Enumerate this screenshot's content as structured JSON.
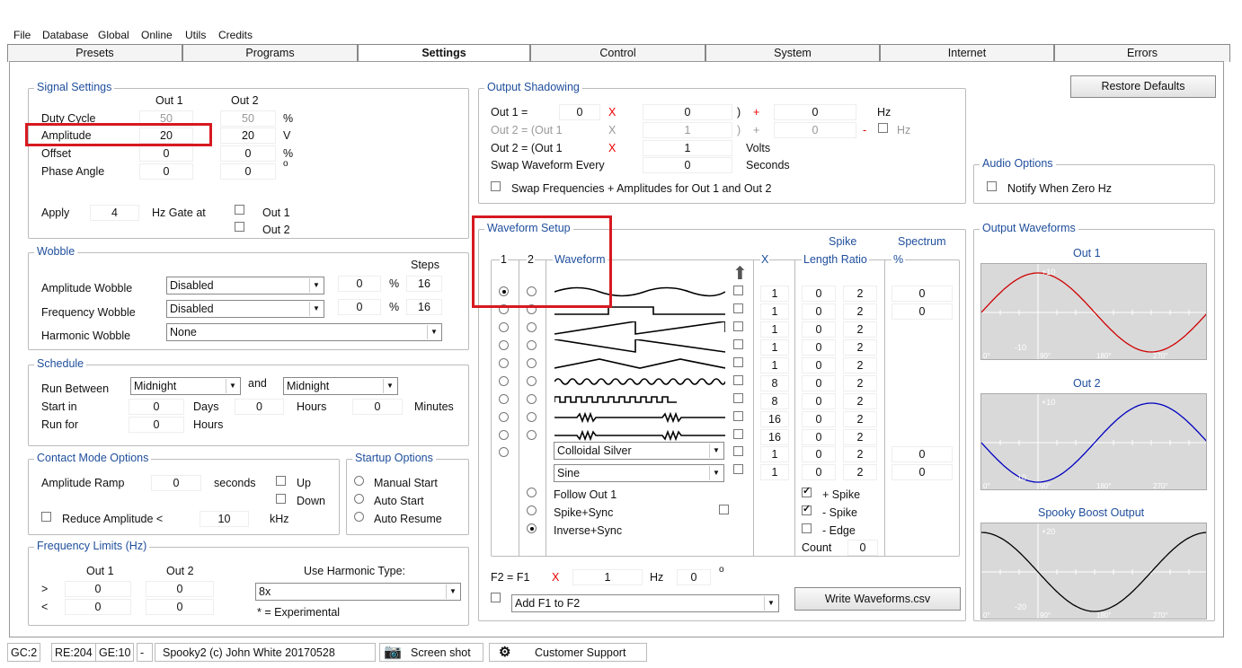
{
  "menu": [
    "File",
    "Database",
    "Global",
    "Online",
    "Utils",
    "Credits"
  ],
  "tabs": [
    "Presets",
    "Programs",
    "Settings",
    "Control",
    "System",
    "Internet",
    "Errors"
  ],
  "signal": {
    "title": "Signal Settings",
    "out1": "Out 1",
    "out2": "Out 2",
    "rows": [
      {
        "label": "Duty Cycle",
        "v1": "50",
        "v2": "50",
        "unit": "%"
      },
      {
        "label": "Amplitude",
        "v1": "20",
        "v2": "20",
        "unit": "V"
      },
      {
        "label": "Offset",
        "v1": "0",
        "v2": "0",
        "unit": "%"
      },
      {
        "label": "Phase Angle",
        "v1": "0",
        "v2": "0",
        "unit": "o"
      }
    ],
    "apply": "Apply",
    "apply_val": "4",
    "hz_gate": "Hz Gate at",
    "gate_out1": "Out 1",
    "gate_out2": "Out 2"
  },
  "wobble": {
    "title": "Wobble",
    "steps": "Steps",
    "amp_label": "Amplitude Wobble",
    "amp_sel": "Disabled",
    "amp_val": "0",
    "amp_pct": "%",
    "amp_steps": "16",
    "freq_label": "Frequency Wobble",
    "freq_sel": "Disabled",
    "freq_val": "0",
    "freq_pct": "%",
    "freq_steps": "16",
    "harm_label": "Harmonic Wobble",
    "harm_sel": "None"
  },
  "schedule": {
    "title": "Schedule",
    "run_between": "Run Between",
    "from": "Midnight",
    "and": "and",
    "to": "Midnight",
    "start_in": "Start in",
    "start_days": "0",
    "days": "Days",
    "start_hours": "0",
    "hours": "Hours",
    "start_min": "0",
    "minutes": "Minutes",
    "run_for": "Run for",
    "run_hours": "0",
    "run_hours_lbl": "Hours"
  },
  "contact": {
    "title": "Contact Mode Options",
    "ramp": "Amplitude Ramp",
    "ramp_val": "0",
    "seconds": "seconds",
    "up": "Up",
    "down": "Down",
    "reduce": "Reduce Amplitude <",
    "reduce_val": "10",
    "khz": "kHz"
  },
  "startup": {
    "title": "Startup Options",
    "opts": [
      "Manual Start",
      "Auto Start",
      "Auto Resume"
    ]
  },
  "freq_limits": {
    "title": "Frequency Limits (Hz)",
    "out1": "Out 1",
    "out2": "Out 2",
    "gt": ">",
    "lt": "<",
    "gt1": "0",
    "gt2": "0",
    "lt1": "0",
    "lt2": "0",
    "harm_label": "Use Harmonic Type:",
    "harm_sel": "8x",
    "note": "* = Experimental"
  },
  "shadow": {
    "title": "Output Shadowing",
    "r1_label": "Out 1 =",
    "r1_a": "0",
    "r1_x": "X",
    "r1_b": "0",
    "r1_paren": ")",
    "r1_plus": "+",
    "r1_c": "0",
    "r1_unit": "Hz",
    "r2_label": "Out 2 = (Out 1",
    "r2_x": "X",
    "r2_b": "1",
    "r2_paren": ")",
    "r2_plus": "+",
    "r2_c": "0",
    "r2_minus": "-",
    "r2_unit": "Hz",
    "r3_label": "Out 2 = (Out 1",
    "r3_x": "X",
    "r3_b": "1",
    "r3_unit": "Volts",
    "swap_label": "Swap Waveform Every",
    "swap_val": "0",
    "swap_unit": "Seconds",
    "swap_freq": "Swap Frequencies + Amplitudes for Out 1 and Out 2"
  },
  "restore": "Restore Defaults",
  "audio": {
    "title": "Audio Options",
    "notify": "Notify When Zero Hz"
  },
  "waveform": {
    "title": "Waveform Setup",
    "c1": "1",
    "c2": "2",
    "cw": "Waveform",
    "cx": "X",
    "spike": "Spike",
    "len_ratio": "Length Ratio",
    "spectrum": "Spectrum",
    "pct": "%",
    "rows": [
      {
        "x": "1",
        "len": "0",
        "ratio": "2",
        "spec": "0"
      },
      {
        "x": "1",
        "len": "0",
        "ratio": "2",
        "spec": "0"
      },
      {
        "x": "1",
        "len": "0",
        "ratio": "2",
        "spec": ""
      },
      {
        "x": "1",
        "len": "0",
        "ratio": "2",
        "spec": ""
      },
      {
        "x": "1",
        "len": "0",
        "ratio": "2",
        "spec": ""
      },
      {
        "x": "8",
        "len": "0",
        "ratio": "2",
        "spec": ""
      },
      {
        "x": "8",
        "len": "0",
        "ratio": "2",
        "spec": ""
      },
      {
        "x": "16",
        "len": "0",
        "ratio": "2",
        "spec": ""
      },
      {
        "x": "16",
        "len": "0",
        "ratio": "2",
        "spec": ""
      },
      {
        "x": "1",
        "len": "0",
        "ratio": "2",
        "spec": "0"
      },
      {
        "x": "1",
        "len": "0",
        "ratio": "2",
        "spec": "0"
      }
    ],
    "sel1": "Colloidal Silver",
    "sel2": "Sine",
    "follow": "Follow Out 1",
    "spike_sync": "Spike+Sync",
    "inverse_sync": "Inverse+Sync",
    "plus_spike": "+ Spike",
    "minus_spike": "- Spike",
    "minus_edge": "- Edge",
    "count": "Count",
    "count_val": "0",
    "f2": "F2 = F1",
    "f2_x": "X",
    "f2_val": "1",
    "f2_hz": "Hz",
    "f2_deg": "0",
    "f2_o": "o",
    "add_sel": "Add F1 to F2",
    "write": "Write Waveforms.csv"
  },
  "outputs": {
    "title": "Output Waveforms",
    "out1": "Out 1",
    "out2": "Out 2",
    "boost": "Spooky Boost Output",
    "colors": {
      "out1": "#d00000",
      "out2": "#0000c0",
      "boost": "#000000"
    },
    "ticks1": {
      "top": "+10",
      "bottom": "-10"
    },
    "ticks3": {
      "top": "+20",
      "bottom": "-20"
    },
    "xticks": [
      "0°",
      "90°",
      "180°",
      "270°"
    ]
  },
  "status": {
    "gc": "GC:2",
    "re": "RE:204",
    "ge": "GE:10",
    "dash": "-",
    "copy": "Spooky2 (c) John White 20170528",
    "screenshot": "Screen shot",
    "support": "Customer Support"
  }
}
